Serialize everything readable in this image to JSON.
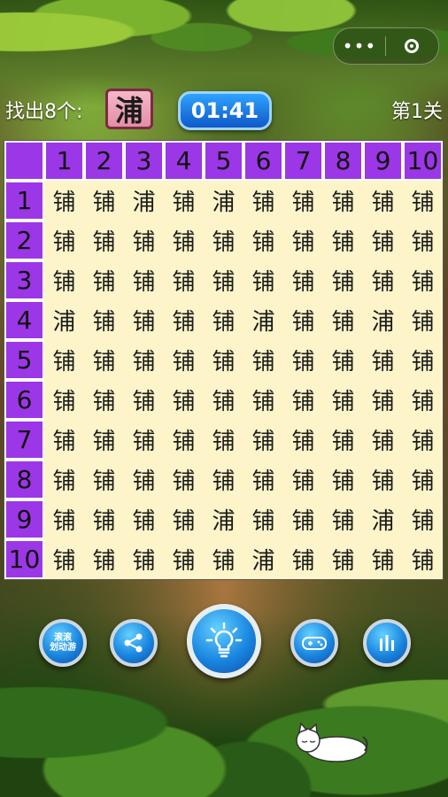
{
  "header": {
    "find_label": "找出8个:",
    "target_char": "浦",
    "timer": "01:41",
    "level": "第1关"
  },
  "grid": {
    "col_headers": [
      "1",
      "2",
      "3",
      "4",
      "5",
      "6",
      "7",
      "8",
      "9",
      "10"
    ],
    "row_headers": [
      "1",
      "2",
      "3",
      "4",
      "5",
      "6",
      "7",
      "8",
      "9",
      "10"
    ],
    "rows": [
      [
        "铺",
        "铺",
        "浦",
        "铺",
        "浦",
        "铺",
        "铺",
        "铺",
        "铺",
        "铺"
      ],
      [
        "铺",
        "铺",
        "铺",
        "铺",
        "铺",
        "铺",
        "铺",
        "铺",
        "铺",
        "铺"
      ],
      [
        "铺",
        "铺",
        "铺",
        "铺",
        "铺",
        "铺",
        "铺",
        "铺",
        "铺",
        "铺"
      ],
      [
        "浦",
        "铺",
        "铺",
        "铺",
        "铺",
        "浦",
        "铺",
        "铺",
        "浦",
        "铺"
      ],
      [
        "铺",
        "铺",
        "铺",
        "铺",
        "铺",
        "铺",
        "铺",
        "铺",
        "铺",
        "铺"
      ],
      [
        "铺",
        "铺",
        "铺",
        "铺",
        "铺",
        "铺",
        "铺",
        "铺",
        "铺",
        "铺"
      ],
      [
        "铺",
        "铺",
        "铺",
        "铺",
        "铺",
        "铺",
        "铺",
        "铺",
        "铺",
        "铺"
      ],
      [
        "铺",
        "铺",
        "铺",
        "铺",
        "铺",
        "铺",
        "铺",
        "铺",
        "铺",
        "铺"
      ],
      [
        "铺",
        "铺",
        "铺",
        "铺",
        "浦",
        "铺",
        "铺",
        "铺",
        "浦",
        "铺"
      ],
      [
        "铺",
        "铺",
        "铺",
        "铺",
        "铺",
        "浦",
        "铺",
        "铺",
        "铺",
        "铺"
      ]
    ]
  },
  "capsule": {
    "menu_icon": "more-dots-icon",
    "close_icon": "close-circle-icon"
  },
  "buttons": {
    "games_label_line1": "滚滚",
    "games_label_line2": "划动游",
    "share_icon": "share-icon",
    "hint_icon": "lightbulb-icon",
    "gamepad_icon": "gamepad-icon",
    "rank_icon": "bar-chart-icon"
  },
  "colors": {
    "header_cell": "#9b37e6",
    "grid_cell": "#fdf5c9",
    "timer": "#1a86e0",
    "target_tile": "#f0a6bb"
  }
}
